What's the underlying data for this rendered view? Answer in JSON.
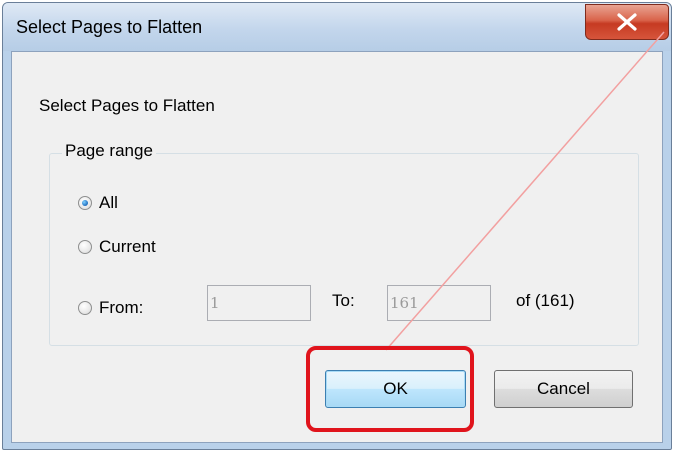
{
  "window": {
    "title": "Select Pages to Flatten",
    "close_icon": "close-icon"
  },
  "dialog": {
    "heading": "Select Pages to Flatten",
    "group_label": "Page range",
    "options": {
      "all": "All",
      "current": "Current",
      "from": "From:"
    },
    "selected_option": "all",
    "from_value": "1",
    "to_label": "To:",
    "to_value": "161",
    "of_label": "of (161)"
  },
  "buttons": {
    "ok": "OK",
    "cancel": "Cancel"
  },
  "annotation": {
    "highlight_color": "#e0141c",
    "line_color": "#f2a0a0"
  }
}
